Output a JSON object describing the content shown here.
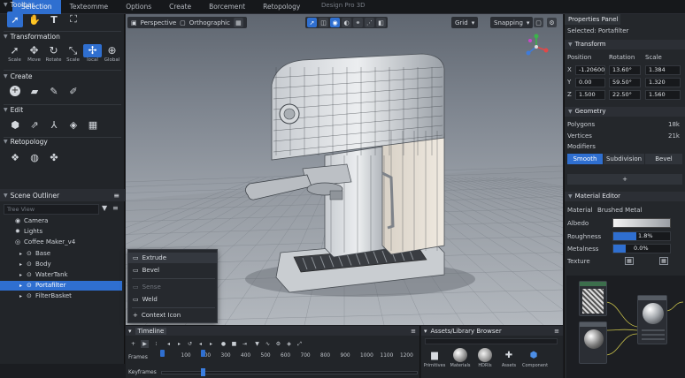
{
  "app": {
    "title": "Design Pro 3D"
  },
  "menu": [
    "Selection",
    "Texteomme",
    "Options",
    "Create",
    "Borcement",
    "Retopology"
  ],
  "left": {
    "toolbar_title": "Toolbar",
    "transform_title": "Transformation",
    "transform_tools": [
      "Scale",
      "Move",
      "Rotate",
      "Scale",
      "local",
      "Global"
    ],
    "create_title": "Create",
    "edit_title": "Edit",
    "retopo_title": "Retopology",
    "outliner_title": "Scene Outliner",
    "tree_placeholder": "Tree View",
    "tree": [
      {
        "label": "Camera",
        "icon": "camera-icon",
        "glyph": "◉",
        "indent": 1,
        "sel": false
      },
      {
        "label": "Lights",
        "icon": "light-icon",
        "glyph": "✹",
        "indent": 1,
        "sel": false
      },
      {
        "label": "Coffee Maker_v4",
        "icon": "object-icon",
        "glyph": "◎",
        "indent": 1,
        "sel": false
      },
      {
        "label": "Base",
        "icon": "mesh-icon",
        "glyph": "⊙",
        "indent": 2,
        "sel": false
      },
      {
        "label": "Body",
        "icon": "mesh-icon",
        "glyph": "⊙",
        "indent": 2,
        "sel": false
      },
      {
        "label": "WaterTank",
        "icon": "mesh-icon",
        "glyph": "⊙",
        "indent": 2,
        "sel": false
      },
      {
        "label": "Portafilter",
        "icon": "mesh-icon",
        "glyph": "⊙",
        "indent": 2,
        "sel": true
      },
      {
        "label": "FilterBasket",
        "icon": "mesh-icon",
        "glyph": "⊙",
        "indent": 2,
        "sel": false
      }
    ]
  },
  "viewport": {
    "perspective_label": "Perspective",
    "ortho_label": "Orthographic",
    "grid_label": "Grid",
    "snapping_label": "Snapping"
  },
  "context_menu": [
    {
      "label": "Extrude",
      "dim": false
    },
    {
      "label": "Bevel",
      "dim": false
    },
    {
      "label": "Sense",
      "dim": true
    },
    {
      "label": "Weld",
      "dim": false
    },
    {
      "label": "Context Icon",
      "dim": false
    }
  ],
  "timeline": {
    "title": "Timeline",
    "frames_label": "Frames",
    "keyframes_label": "Keyframes",
    "ticks": [
      "0",
      "100",
      "200",
      "300",
      "400",
      "500",
      "600",
      "700",
      "800",
      "900",
      "1000",
      "1100",
      "1200"
    ]
  },
  "assets": {
    "title": "Assets/Library Browser",
    "items": [
      "Primitives",
      "Materials",
      "HDRIs",
      "Assets",
      "Component"
    ]
  },
  "properties": {
    "title": "Properties Panel",
    "selected": "Selected: Portafilter",
    "transform_title": "Transform",
    "col_position": "Position",
    "col_rotation": "Rotation",
    "col_scale": "Scale",
    "rows": [
      {
        "axis": "X",
        "pos": "-1.20600",
        "rot": "13.60°",
        "scale": "1.384"
      },
      {
        "axis": "Y",
        "pos": "0.00",
        "rot": "59.50°",
        "scale": "1.320"
      },
      {
        "axis": "Z",
        "pos": "1.500",
        "rot": "22.50°",
        "scale": "1.560"
      }
    ],
    "geometry_title": "Geometry",
    "polygons_label": "Polygons",
    "polygons_value": "18k",
    "vertices_label": "Vertices",
    "vertices_value": "21k",
    "modifiers_label": "Modifiers",
    "mod_smooth": "Smooth",
    "mod_subdivision": "Subdivision",
    "mod_bevel": "Bevel",
    "add_label": "+",
    "material_title": "Material Editor",
    "material_label": "Material",
    "material_value": "Brushed Metal",
    "albedo_label": "Albedo",
    "roughness_label": "Roughness",
    "roughness_value": "1.8%",
    "metalness_label": "Metalness",
    "metalness_value": "0.0%",
    "texture_label": "Texture"
  },
  "colors": {
    "accent": "#2f6fd0",
    "panel": "#24272b",
    "viewport_top": "#5f6670"
  }
}
